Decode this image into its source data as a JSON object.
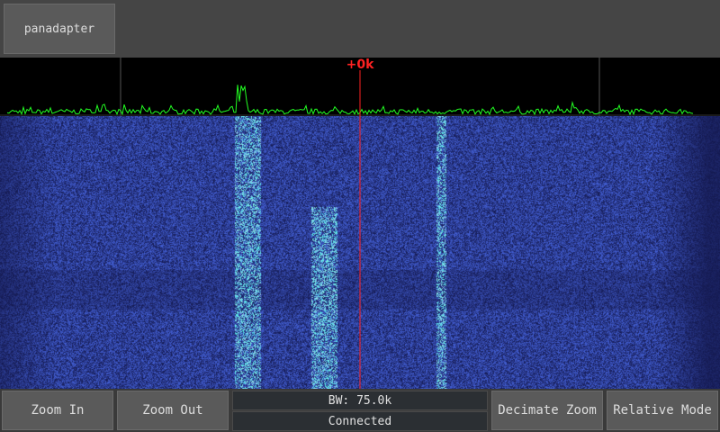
{
  "top": {
    "mode_button": "panadapter"
  },
  "spectrum": {
    "center_label": "+0k",
    "trace_color": "#22ff22",
    "center_line_color": "#ff2222"
  },
  "controls": {
    "zoom_in": "Zoom In",
    "zoom_out": "Zoom Out",
    "decimate_zoom": "Decimate Zoom",
    "relative_mode": "Relative Mode"
  },
  "status": {
    "bandwidth": "BW: 75.0k",
    "connection": "Connected"
  }
}
